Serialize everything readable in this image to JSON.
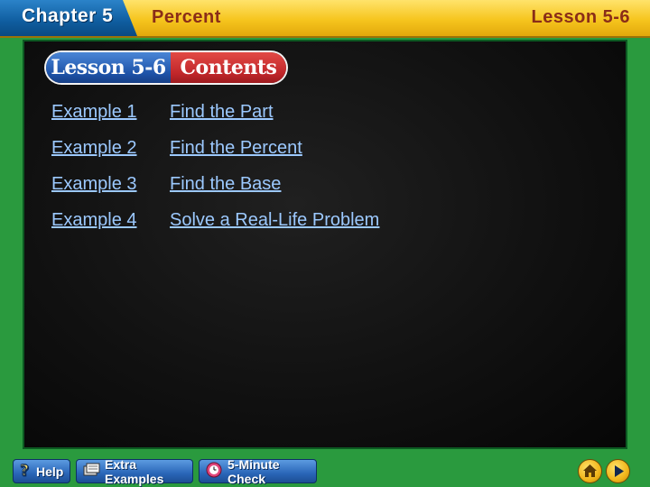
{
  "header": {
    "chapter": "Chapter 5",
    "title": "Percent",
    "lesson": "Lesson 5-6"
  },
  "banner": {
    "lesson": "Lesson 5-6",
    "contents": "Contents"
  },
  "examples": [
    {
      "number": "Example 1",
      "title": "Find the Part"
    },
    {
      "number": "Example 2",
      "title": "Find the Percent"
    },
    {
      "number": "Example 3",
      "title": "Find the Base"
    },
    {
      "number": "Example 4",
      "title": "Solve a Real-Life Problem"
    }
  ],
  "footer": {
    "help": "Help",
    "extra_examples": "Extra Examples",
    "five_minute_check": "5-Minute Check"
  },
  "colors": {
    "header_yellow": "#f6c51e",
    "chapter_blue": "#0f5d9f",
    "board_black": "#111111",
    "frame_green": "#2a9a3e",
    "link_blue": "#9cc9ff",
    "contents_red": "#c0262a"
  },
  "icons": {
    "help": "question-mark-icon",
    "extra_examples": "stack-of-papers-icon",
    "five_minute_check": "clock-icon",
    "home": "home-icon",
    "next": "play-arrow-icon"
  }
}
